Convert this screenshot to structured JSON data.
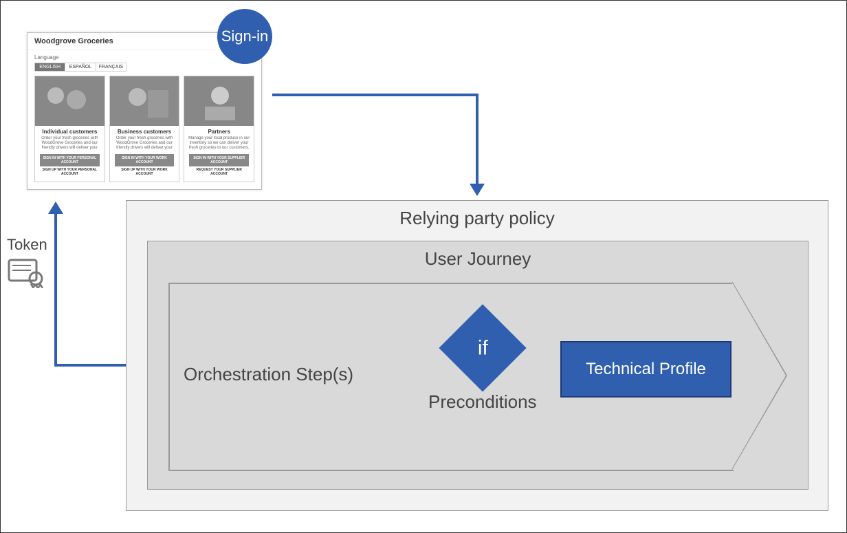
{
  "signin_label": "Sign-in",
  "token_label": "Token",
  "relying_party": {
    "title": "Relying party policy",
    "user_journey_title": "User Journey",
    "orchestration_label": "Orchestration Step(s)",
    "preconditions": {
      "if": "if",
      "label": "Preconditions"
    },
    "technical_profile": "Technical Profile"
  },
  "screenshot": {
    "brand": "Woodgrove Groceries",
    "language_label": "Language",
    "tabs": [
      "ENGLISH",
      "ESPAÑOL",
      "FRANÇAIS"
    ],
    "cards": [
      {
        "title": "Individual customers",
        "desc": "Order your fresh groceries with WoodGrove Groceries and our friendly drivers will deliver your grocery shopping to your home door.",
        "button": "SIGN IN WITH YOUR PERSONAL ACCOUNT",
        "link": "SIGN UP WITH YOUR PERSONAL ACCOUNT"
      },
      {
        "title": "Business customers",
        "desc": "Order your fresh groceries with WoodGrove Groceries and our friendly drivers will deliver your grocery shopping to your office door.",
        "button": "SIGN IN WITH YOUR WORK ACCOUNT",
        "link": "SIGN UP WITH YOUR WORK ACCOUNT"
      },
      {
        "title": "Partners",
        "desc": "Manage your local produce in our inventory so we can deliver your fresh groceries to our customers.",
        "button": "SIGN IN WITH YOUR SUPPLIER ACCOUNT",
        "link": "REQUEST YOUR SUPPLIER ACCOUNT"
      }
    ]
  }
}
